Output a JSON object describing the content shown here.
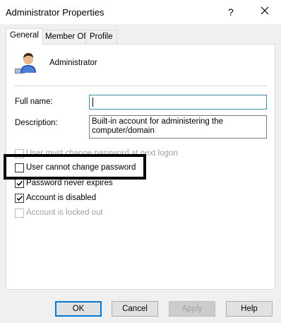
{
  "window": {
    "title": "Administrator Properties",
    "help_glyph": "?"
  },
  "tabs": [
    {
      "label": "General",
      "active": true
    },
    {
      "label": "Member Of",
      "active": false
    },
    {
      "label": "Profile",
      "active": false
    }
  ],
  "general": {
    "username": "Administrator",
    "full_name_label": "Full name:",
    "full_name_value": "",
    "description_label": "Description:",
    "description_value": "Built-in account for administering the computer/domain"
  },
  "options": [
    {
      "label": "User must change password at next logon",
      "checked": false,
      "enabled": false
    },
    {
      "label": "User cannot change password",
      "checked": false,
      "enabled": true
    },
    {
      "label": "Password never expires",
      "checked": true,
      "enabled": true
    },
    {
      "label": "Account is disabled",
      "checked": true,
      "enabled": true
    },
    {
      "label": "Account is locked out",
      "checked": false,
      "enabled": false
    }
  ],
  "buttons": {
    "ok": "OK",
    "cancel": "Cancel",
    "apply": "Apply",
    "help": "Help"
  },
  "icons": {
    "user": "user-icon",
    "close": "close-icon",
    "check": "checkmark-icon"
  },
  "colors": {
    "focus_border": "#3c8fa3",
    "default_button_border": "#0078d7",
    "highlight_box": "#000000"
  }
}
